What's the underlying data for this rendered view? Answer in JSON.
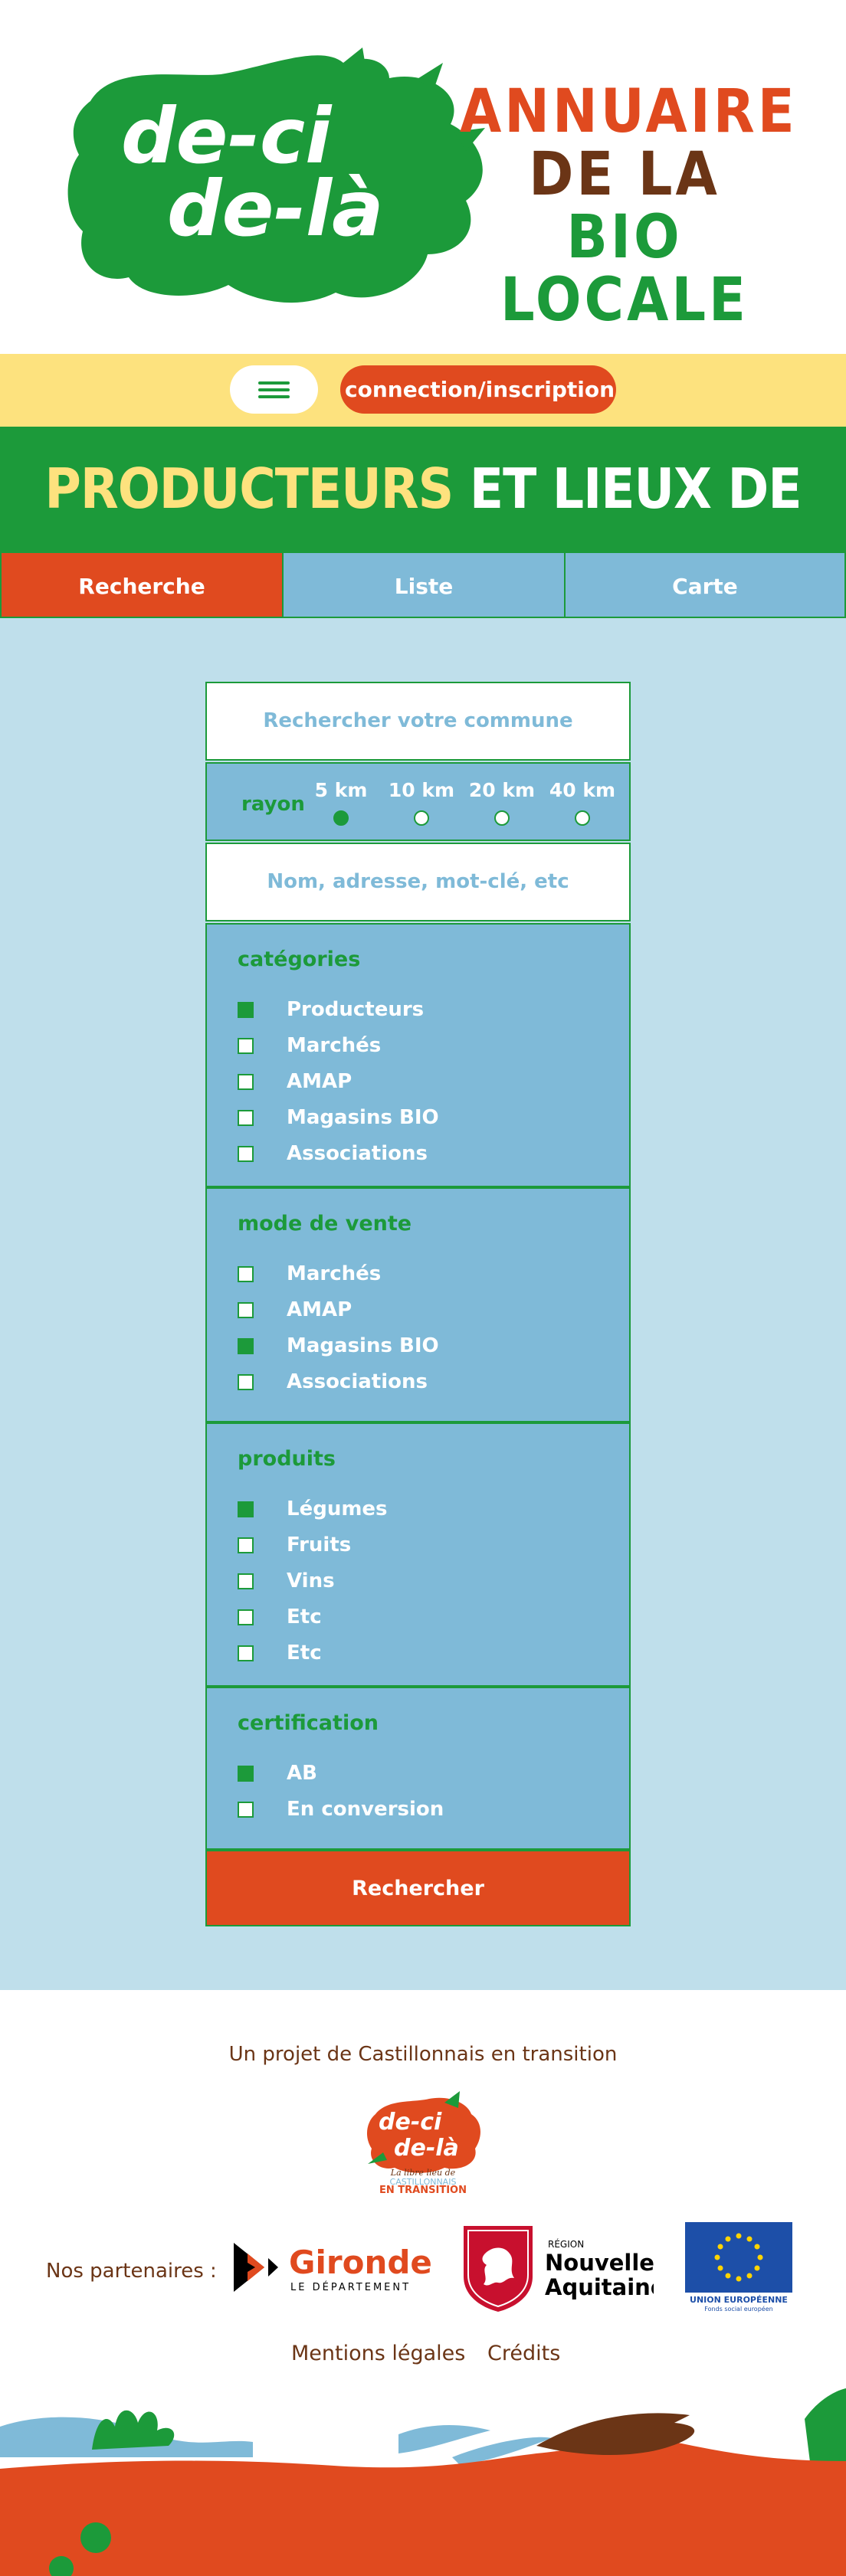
{
  "header": {
    "logo_text_line1": "de-ci",
    "logo_text_line2": "de-là",
    "annuaire": [
      "ANNUAIRE",
      "DE LA",
      "BIO LOCALE"
    ]
  },
  "topbar": {
    "menu_icon": "hamburger-icon",
    "connect_label": "connection/inscription"
  },
  "title": {
    "part1": "PRODUCTEURS",
    "part2": " ET LIEUX DE VENTE"
  },
  "tabs": [
    {
      "label": "Recherche",
      "active": true
    },
    {
      "label": "Liste",
      "active": false
    },
    {
      "label": "Carte",
      "active": false
    }
  ],
  "search": {
    "commune_placeholder": "Rechercher votre commune",
    "rayon_label": "rayon",
    "rayon_options": [
      {
        "label": "5 km",
        "selected": true
      },
      {
        "label": "10 km",
        "selected": false
      },
      {
        "label": "20 km",
        "selected": false
      },
      {
        "label": "40 km",
        "selected": false
      }
    ],
    "keyword_placeholder": "Nom, adresse, mot-clé, etc"
  },
  "filters": {
    "categories": {
      "title": "catégories",
      "options": [
        {
          "label": "Producteurs",
          "checked": true
        },
        {
          "label": "Marchés",
          "checked": false
        },
        {
          "label": "AMAP",
          "checked": false
        },
        {
          "label": "Magasins BIO",
          "checked": false
        },
        {
          "label": "Associations",
          "checked": false
        }
      ]
    },
    "mode": {
      "title": "mode de vente",
      "options": [
        {
          "label": "Marchés",
          "checked": false
        },
        {
          "label": "AMAP",
          "checked": false
        },
        {
          "label": "Magasins BIO",
          "checked": true
        },
        {
          "label": "Associations",
          "checked": false
        }
      ]
    },
    "produits": {
      "title": "produits",
      "options": [
        {
          "label": "Légumes",
          "checked": true
        },
        {
          "label": "Fruits",
          "checked": false
        },
        {
          "label": "Vins",
          "checked": false
        },
        {
          "label": "Etc",
          "checked": false
        },
        {
          "label": "Etc",
          "checked": false
        }
      ]
    },
    "certification": {
      "title": "certification",
      "options": [
        {
          "label": "AB",
          "checked": true
        },
        {
          "label": "En conversion",
          "checked": false
        }
      ]
    }
  },
  "search_button": "Rechercher",
  "footer": {
    "projet": "Un projet de Castillonnais en transition",
    "small_logo_line1": "de-ci",
    "small_logo_line2": "de-là",
    "small_logo_tagline": "La libre lieu de",
    "small_logo_name": "CASTILLONNAIS",
    "small_logo_transition": "EN TRANSITION",
    "partners_label": "Nos partenaires :",
    "gironde_name": "Gironde",
    "gironde_sub": "LE DÉPARTEMENT",
    "na_region": "RÉGION",
    "na_name1": "Nouvelle-",
    "na_name2": "Aquitaine",
    "eu_name": "UNION EUROPÉENNE",
    "eu_sub": "Fonds social européen",
    "mentions": "Mentions légales",
    "credits": "Crédits"
  },
  "colors": {
    "green": "#1c9a3a",
    "red": "#e04a1f",
    "brown": "#6b3516",
    "yellow": "#fde27e",
    "blue": "#7fbad8",
    "lightblue": "#bfdfeb"
  }
}
